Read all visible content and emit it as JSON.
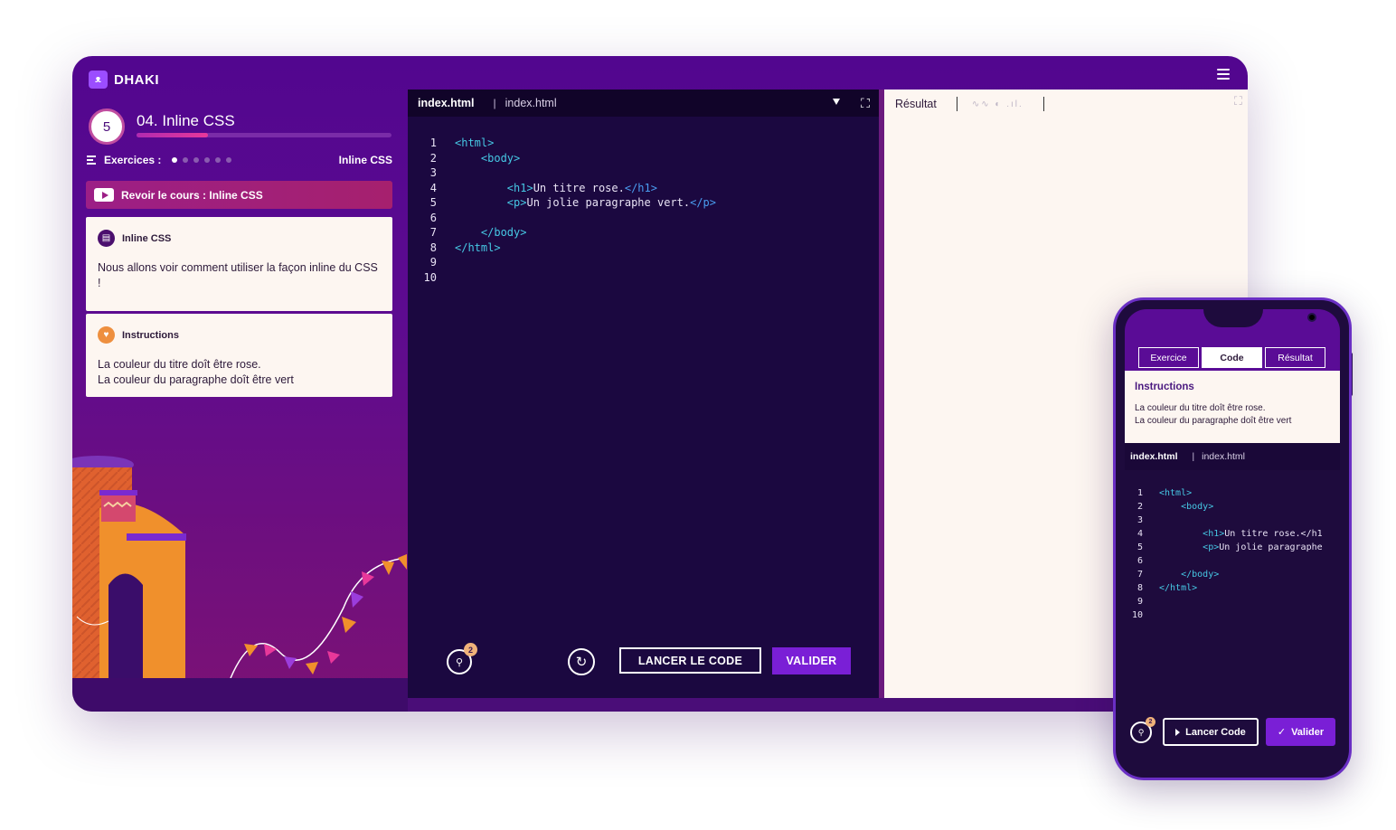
{
  "app": {
    "name": "DHAKI",
    "logo_glyph": "ᴥ"
  },
  "lesson": {
    "number_title": "04. Inline CSS",
    "progress": 0.28,
    "badge_glyph": "5"
  },
  "exercises": {
    "label": "Exercices :",
    "total": 6,
    "current": 1,
    "topic": "Inline CSS"
  },
  "review": {
    "label": "Revoir le cours : Inline CSS"
  },
  "cards": {
    "intro": {
      "title": "Inline CSS",
      "text": "Nous allons voir comment utiliser la façon inline du CSS !"
    },
    "instructions": {
      "title": "Instructions",
      "lines": [
        "La couleur du titre doît être rose.",
        "La couleur du paragraphe doît être vert"
      ]
    }
  },
  "editor": {
    "active_tab": "index.html",
    "tab": "index.html",
    "lines": [
      {
        "num": "1",
        "parts": [
          [
            "tag",
            "<html>"
          ]
        ]
      },
      {
        "num": "2",
        "parts": [
          [
            "txt",
            "    "
          ],
          [
            "tag",
            "<body>"
          ]
        ]
      },
      {
        "num": "3",
        "parts": []
      },
      {
        "num": "4",
        "parts": [
          [
            "txt",
            "        "
          ],
          [
            "tag",
            "<h1>"
          ],
          [
            "txt",
            "Un titre rose."
          ],
          [
            "etag",
            "</h1>"
          ]
        ]
      },
      {
        "num": "5",
        "parts": [
          [
            "txt",
            "        "
          ],
          [
            "tag",
            "<p>"
          ],
          [
            "txt",
            "Un jolie paragraphe vert."
          ],
          [
            "etag",
            "</p>"
          ]
        ]
      },
      {
        "num": "6",
        "parts": []
      },
      {
        "num": "7",
        "parts": [
          [
            "txt",
            "    "
          ],
          [
            "tag",
            "</body>"
          ]
        ]
      },
      {
        "num": "8",
        "parts": [
          [
            "tag",
            "</html>"
          ]
        ]
      },
      {
        "num": "9",
        "parts": []
      },
      {
        "num": "10",
        "parts": []
      }
    ],
    "hint_count": "2",
    "run_label": "LANCER LE CODE",
    "validate_label": "VALIDER"
  },
  "result": {
    "title": "Résultat",
    "tools": "∿∿ ◐ .ıl."
  },
  "phone": {
    "tabs": [
      "Exercice",
      "Code",
      "Résultat"
    ],
    "active_tab": 1,
    "instructions_title": "Instructions",
    "instructions_lines": [
      "La couleur du titre doît être rose.",
      "La couleur du paragraphe doît être vert"
    ],
    "file_active": "index.html",
    "file_tab": "index.html",
    "lines": [
      {
        "num": "1",
        "parts": [
          [
            "tag",
            "<html>"
          ]
        ]
      },
      {
        "num": "2",
        "parts": [
          [
            "txt",
            "    "
          ],
          [
            "tag",
            "<body>"
          ]
        ]
      },
      {
        "num": "3",
        "parts": []
      },
      {
        "num": "4",
        "parts": [
          [
            "txt",
            "        "
          ],
          [
            "tag",
            "<h1>"
          ],
          [
            "txt",
            "Un titre rose.</h1"
          ]
        ]
      },
      {
        "num": "5",
        "parts": [
          [
            "txt",
            "        "
          ],
          [
            "tag",
            "<p>"
          ],
          [
            "txt",
            "Un jolie paragraphe"
          ]
        ]
      },
      {
        "num": "6",
        "parts": []
      },
      {
        "num": "7",
        "parts": [
          [
            "txt",
            "    "
          ],
          [
            "tag",
            "</body>"
          ]
        ]
      },
      {
        "num": "8",
        "parts": [
          [
            "tag",
            "</html>"
          ]
        ]
      },
      {
        "num": "9",
        "parts": []
      },
      {
        "num": "10",
        "parts": []
      }
    ],
    "hint_count": "2",
    "run_label": "Lancer Code",
    "validate_label": "Valider",
    "check_glyph": "✓"
  },
  "colors": {
    "brand_purple": "#5a0c96",
    "accent_violet": "#7a1fd6",
    "pink": "#e8389a",
    "tag_cyan": "#46c8e4",
    "editor_bg": "#1b0840",
    "paper": "#fdf6f1"
  }
}
